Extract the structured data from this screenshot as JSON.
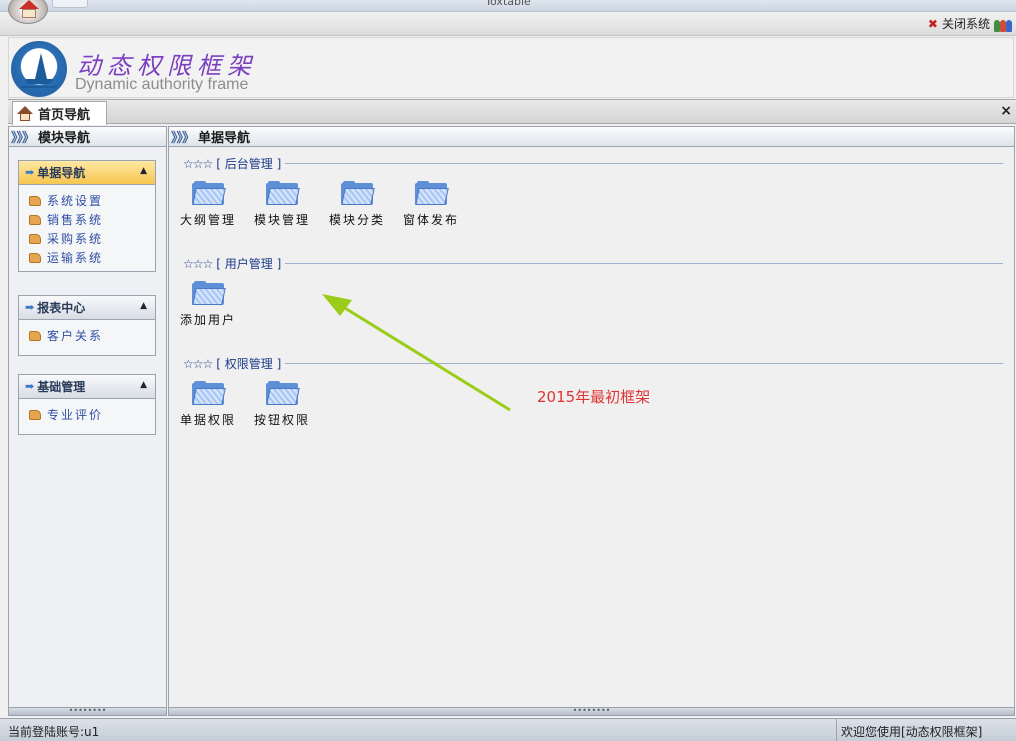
{
  "window": {
    "title": "Toxtable"
  },
  "topbar": {
    "close_label": "关闭系统"
  },
  "banner": {
    "title_cn": "动态权限框架",
    "title_en": "Dynamic authority frame"
  },
  "tabs": [
    {
      "label": "首页导航"
    }
  ],
  "left_panel": {
    "title": "模块导航",
    "groups": [
      {
        "title": "单据导航",
        "items": [
          "系统设置",
          "销售系统",
          "采购系统",
          "运输系统"
        ]
      },
      {
        "title": "报表中心",
        "items": [
          "客户关系"
        ]
      },
      {
        "title": "基础管理",
        "items": [
          "专业评价"
        ]
      }
    ]
  },
  "right_panel": {
    "title": "单据导航",
    "sections": [
      {
        "stars": "☆☆☆",
        "title": "[ 后台管理 ]",
        "tiles": [
          "大纲管理",
          "模块管理",
          "模块分类",
          "窗体发布"
        ]
      },
      {
        "stars": "☆☆☆",
        "title": "[ 用户管理 ]",
        "tiles": [
          "添加用户"
        ]
      },
      {
        "stars": "☆☆☆",
        "title": "[ 权限管理 ]",
        "tiles": [
          "单据权限",
          "按钮权限"
        ]
      }
    ]
  },
  "annotation": {
    "text": "2015年最初框架",
    "color": "#e03333"
  },
  "statusbar": {
    "left": "当前登陆账号:u1",
    "right": "欢迎您使用[动态权限框架]"
  },
  "icons": {
    "chevrons": "》》》",
    "close": "×",
    "collapse": "▲",
    "group_arrow": "➡"
  }
}
